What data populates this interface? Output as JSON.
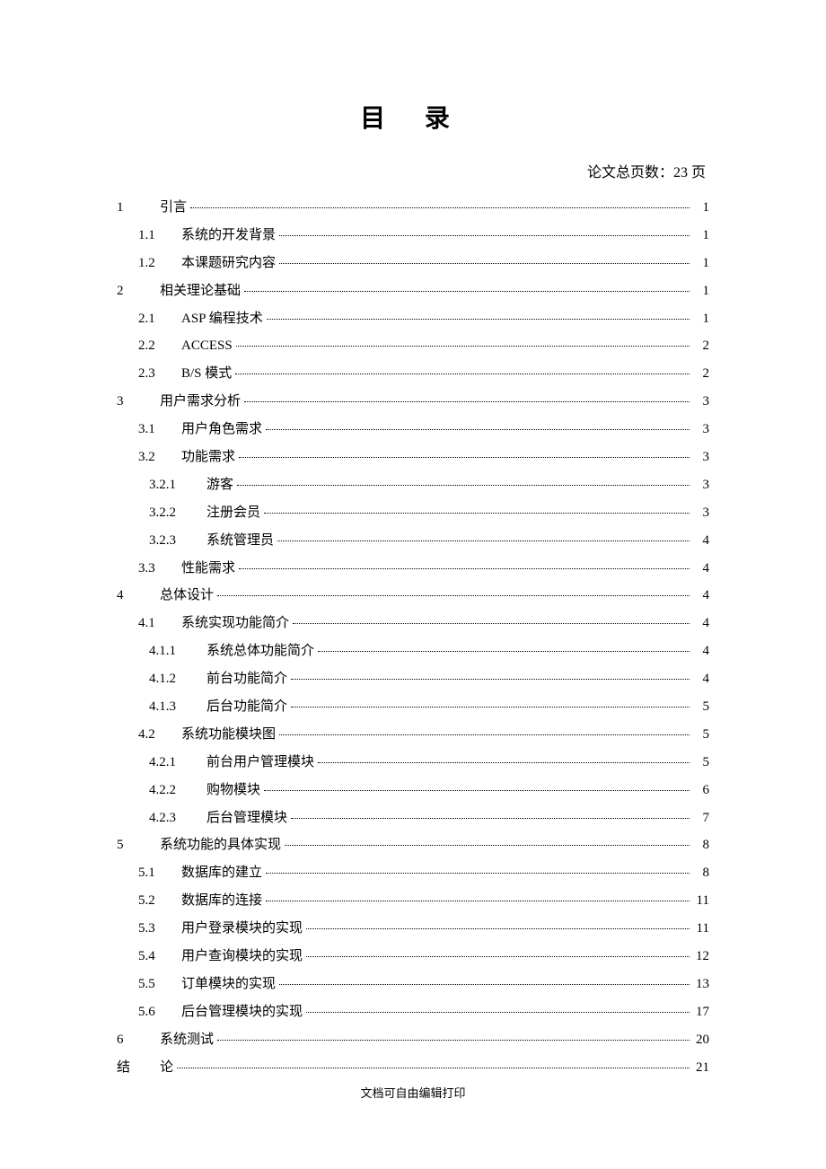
{
  "title": "目 录",
  "page_count_text": "论文总页数：23 页",
  "footer": "文档可自由编辑打印",
  "toc": [
    {
      "level": 1,
      "num": "1",
      "label": "引言",
      "page": "1"
    },
    {
      "level": 2,
      "num": "1.1",
      "label": "系统的开发背景",
      "page": "1"
    },
    {
      "level": 2,
      "num": "1.2",
      "label": "本课题研究内容",
      "page": "1"
    },
    {
      "level": 1,
      "num": "2",
      "label": "相关理论基础",
      "page": "1"
    },
    {
      "level": 2,
      "num": "2.1",
      "label": "ASP 编程技术",
      "page": "1"
    },
    {
      "level": 2,
      "num": "2.2",
      "label": "ACCESS",
      "page": "2"
    },
    {
      "level": 2,
      "num": "2.3",
      "label": "B/S 模式",
      "page": "2"
    },
    {
      "level": 1,
      "num": "3",
      "label": "用户需求分析",
      "page": "3"
    },
    {
      "level": 2,
      "num": "3.1",
      "label": "用户角色需求",
      "page": "3"
    },
    {
      "level": 2,
      "num": "3.2",
      "label": "功能需求",
      "page": "3"
    },
    {
      "level": 3,
      "num": "3.2.1",
      "label": "游客",
      "page": "3"
    },
    {
      "level": 3,
      "num": "3.2.2",
      "label": "注册会员",
      "page": "3"
    },
    {
      "level": 3,
      "num": "3.2.3",
      "label": "系统管理员",
      "page": "4"
    },
    {
      "level": 2,
      "num": "3.3",
      "label": "性能需求",
      "page": "4"
    },
    {
      "level": 1,
      "num": "4",
      "label": "总体设计",
      "page": "4"
    },
    {
      "level": 2,
      "num": "4.1",
      "label": "系统实现功能简介",
      "page": "4"
    },
    {
      "level": 3,
      "num": "4.1.1",
      "label": "系统总体功能简介",
      "page": "4"
    },
    {
      "level": 3,
      "num": "4.1.2",
      "label": "前台功能简介",
      "page": "4"
    },
    {
      "level": 3,
      "num": "4.1.3",
      "label": "后台功能简介",
      "page": "5"
    },
    {
      "level": 2,
      "num": "4.2",
      "label": "系统功能模块图",
      "page": "5"
    },
    {
      "level": 3,
      "num": "4.2.1",
      "label": "前台用户管理模块",
      "page": "5"
    },
    {
      "level": 3,
      "num": "4.2.2",
      "label": "购物模块",
      "page": "6"
    },
    {
      "level": 3,
      "num": "4.2.3",
      "label": "后台管理模块",
      "page": "7"
    },
    {
      "level": 1,
      "num": "5",
      "label": "系统功能的具体实现",
      "page": "8"
    },
    {
      "level": 2,
      "num": "5.1",
      "label": "数据库的建立",
      "page": "8"
    },
    {
      "level": 2,
      "num": "5.2",
      "label": "数据库的连接",
      "page": "11"
    },
    {
      "level": 2,
      "num": "5.3",
      "label": "用户登录模块的实现",
      "page": "11"
    },
    {
      "level": 2,
      "num": "5.4",
      "label": "用户查询模块的实现",
      "page": "12"
    },
    {
      "level": 2,
      "num": "5.5",
      "label": "订单模块的实现",
      "page": "13"
    },
    {
      "level": 2,
      "num": "5.6",
      "label": "后台管理模块的实现",
      "page": "17"
    },
    {
      "level": 1,
      "num": "6",
      "label": "系统测试",
      "page": "20"
    },
    {
      "level": 1,
      "num": "结",
      "label": "论",
      "page": "21"
    }
  ]
}
